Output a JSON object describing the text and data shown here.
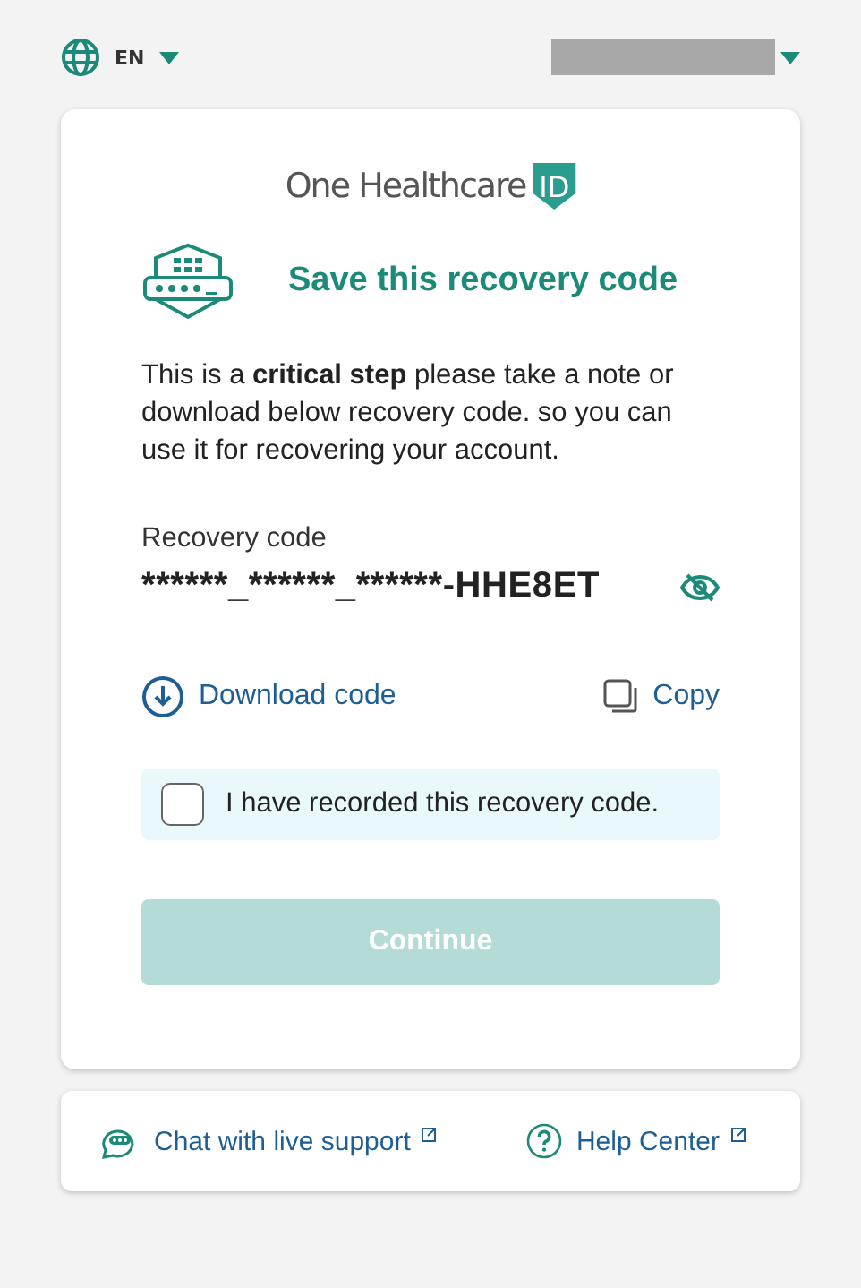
{
  "language": {
    "label": "EN"
  },
  "account_menu": {
    "redacted": true
  },
  "logo": {
    "name": "One Healthcare",
    "badge": "ID"
  },
  "title": "Save this recovery code",
  "message": "This is a **critical step** please take a note or download below recovery code. so you can use it for recovering your account.",
  "recovery_code": {
    "label": "Recovery code",
    "value": "******_******_******-HHE8ET",
    "hidden": true
  },
  "actions": [
    {
      "kind": "download",
      "label": "Download code"
    },
    {
      "kind": "copy",
      "label": "Copy"
    }
  ],
  "confirm": {
    "label": "I have recorded this recovery code.",
    "checked": false
  },
  "continue_button": {
    "label": "Continue",
    "disabled": true
  },
  "footer_links": [
    {
      "kind": "chat",
      "label": "Chat with live support"
    },
    {
      "kind": "help",
      "label": "Help Center"
    }
  ]
}
